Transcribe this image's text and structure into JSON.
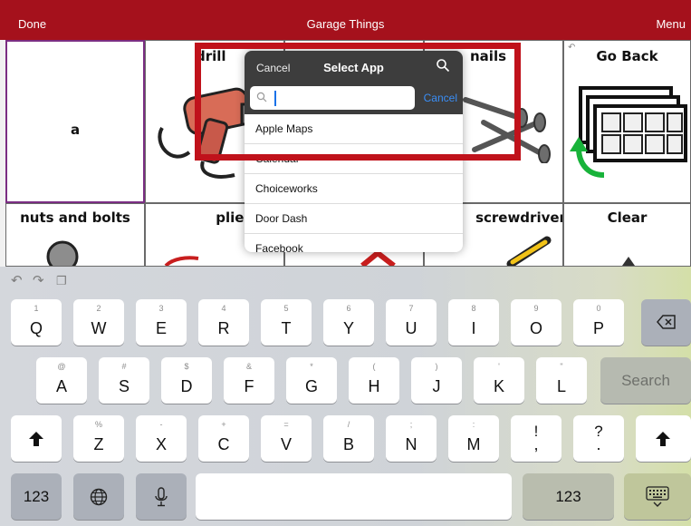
{
  "top_bar": {
    "done_label": "Done",
    "title": "Garage Things",
    "menu_label": "Menu"
  },
  "grid": {
    "cells": [
      {
        "label": "a",
        "icon": "none"
      },
      {
        "label": "drill",
        "icon": "drill-icon"
      },
      {
        "label": "nails",
        "icon": "nails-icon"
      },
      {
        "label": "Go Back",
        "icon": "board-pages-icon"
      },
      {
        "label": "nuts and bolts",
        "icon": "nuts-bolts-icon"
      },
      {
        "label": "pliers",
        "icon": "pliers-icon"
      },
      {
        "label": "screwdriver",
        "icon": "screwdriver-icon"
      },
      {
        "label": "Clear",
        "icon": "clear-icon"
      }
    ]
  },
  "select_app_popover": {
    "cancel_label": "Cancel",
    "title": "Select App",
    "search_cancel_label": "Cancel",
    "search_value": "",
    "apps": [
      "Apple Maps",
      "Calendar",
      "Choiceworks",
      "Door Dash",
      "Facebook"
    ]
  },
  "keyboard": {
    "row1": [
      {
        "main": "Q",
        "alt": "1"
      },
      {
        "main": "W",
        "alt": "2"
      },
      {
        "main": "E",
        "alt": "3"
      },
      {
        "main": "R",
        "alt": "4"
      },
      {
        "main": "T",
        "alt": "5"
      },
      {
        "main": "Y",
        "alt": "6"
      },
      {
        "main": "U",
        "alt": "7"
      },
      {
        "main": "I",
        "alt": "8"
      },
      {
        "main": "O",
        "alt": "9"
      },
      {
        "main": "P",
        "alt": "0"
      }
    ],
    "row2": [
      {
        "main": "A",
        "alt": "@"
      },
      {
        "main": "S",
        "alt": "#"
      },
      {
        "main": "D",
        "alt": "$"
      },
      {
        "main": "F",
        "alt": "&"
      },
      {
        "main": "G",
        "alt": "*"
      },
      {
        "main": "H",
        "alt": "("
      },
      {
        "main": "J",
        "alt": ")"
      },
      {
        "main": "K",
        "alt": "'"
      },
      {
        "main": "L",
        "alt": "\""
      }
    ],
    "row3": [
      {
        "main": "Z",
        "alt": "%"
      },
      {
        "main": "X",
        "alt": "-"
      },
      {
        "main": "C",
        "alt": "+"
      },
      {
        "main": "V",
        "alt": "="
      },
      {
        "main": "B",
        "alt": "/"
      },
      {
        "main": "N",
        "alt": ";"
      },
      {
        "main": "M",
        "alt": ":"
      },
      {
        "main": ",",
        "alt": "!"
      },
      {
        "main": ".",
        "alt": "?"
      }
    ],
    "search_label": "Search",
    "numbers_label": "123",
    "numbers_label_right": "123",
    "icons": [
      "undo-icon",
      "redo-icon",
      "paste-icon",
      "delete-icon",
      "shift-icon",
      "globe-icon",
      "microphone-icon",
      "hide-keyboard-icon"
    ]
  }
}
